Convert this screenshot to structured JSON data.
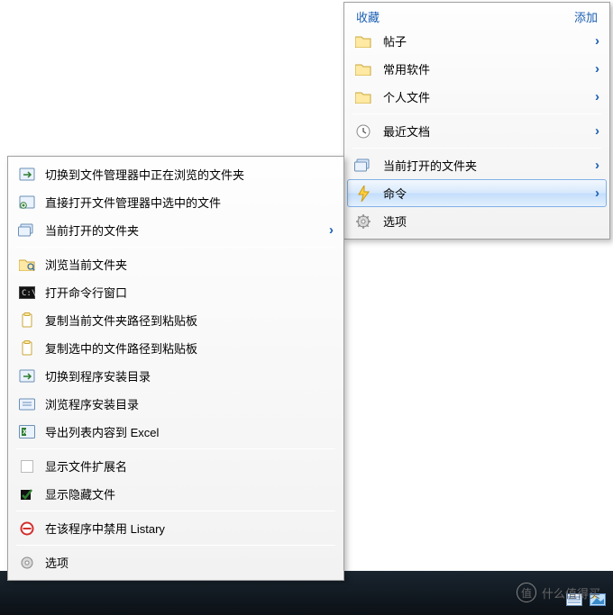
{
  "colors": {
    "accent": "#1a5fb4",
    "highlight_border": "#7fb1e8"
  },
  "right_menu": {
    "header_left": "收藏",
    "header_right": "添加",
    "items": [
      {
        "label": "帖子",
        "icon": "folder-icon",
        "submenu": true
      },
      {
        "label": "常用软件",
        "icon": "folder-icon",
        "submenu": true
      },
      {
        "label": "个人文件",
        "icon": "folder-icon",
        "submenu": true
      }
    ],
    "recent": {
      "label": "最近文档",
      "icon": "clock-icon",
      "submenu": true
    },
    "open_folder": {
      "label": "当前打开的文件夹",
      "icon": "folders-icon",
      "submenu": true
    },
    "command": {
      "label": "命令",
      "icon": "bolt-icon",
      "submenu": true,
      "highlighted": true
    },
    "options": {
      "label": "选项",
      "icon": "gear-icon",
      "submenu": false
    }
  },
  "left_menu": {
    "items1": [
      {
        "label": "切换到文件管理器中正在浏览的文件夹",
        "icon": "switch-icon"
      },
      {
        "label": "直接打开文件管理器中选中的文件",
        "icon": "open-icon"
      },
      {
        "label": "当前打开的文件夹",
        "icon": "folders-icon",
        "submenu": true
      }
    ],
    "items2": [
      {
        "label": "浏览当前文件夹",
        "icon": "browse-icon"
      },
      {
        "label": "打开命令行窗口",
        "icon": "terminal-icon"
      },
      {
        "label": "复制当前文件夹路径到粘贴板",
        "icon": "copy-icon"
      },
      {
        "label": "复制选中的文件路径到粘贴板",
        "icon": "copy-icon"
      },
      {
        "label": "切换到程序安装目录",
        "icon": "switch-icon"
      },
      {
        "label": "浏览程序安装目录",
        "icon": "browse-dir-icon"
      },
      {
        "label": "导出列表内容到 Excel",
        "icon": "export-icon"
      }
    ],
    "items3": [
      {
        "label": "显示文件扩展名",
        "icon": "blank-icon",
        "checked": false
      },
      {
        "label": "显示隐藏文件",
        "icon": "blank-icon",
        "checked": true
      }
    ],
    "disable": {
      "label": "在该程序中禁用 Listary",
      "icon": "forbid-icon"
    },
    "options": {
      "label": "选项",
      "icon": "gear-icon"
    }
  },
  "watermark": {
    "text": "什么值得买",
    "glyph": "值"
  }
}
